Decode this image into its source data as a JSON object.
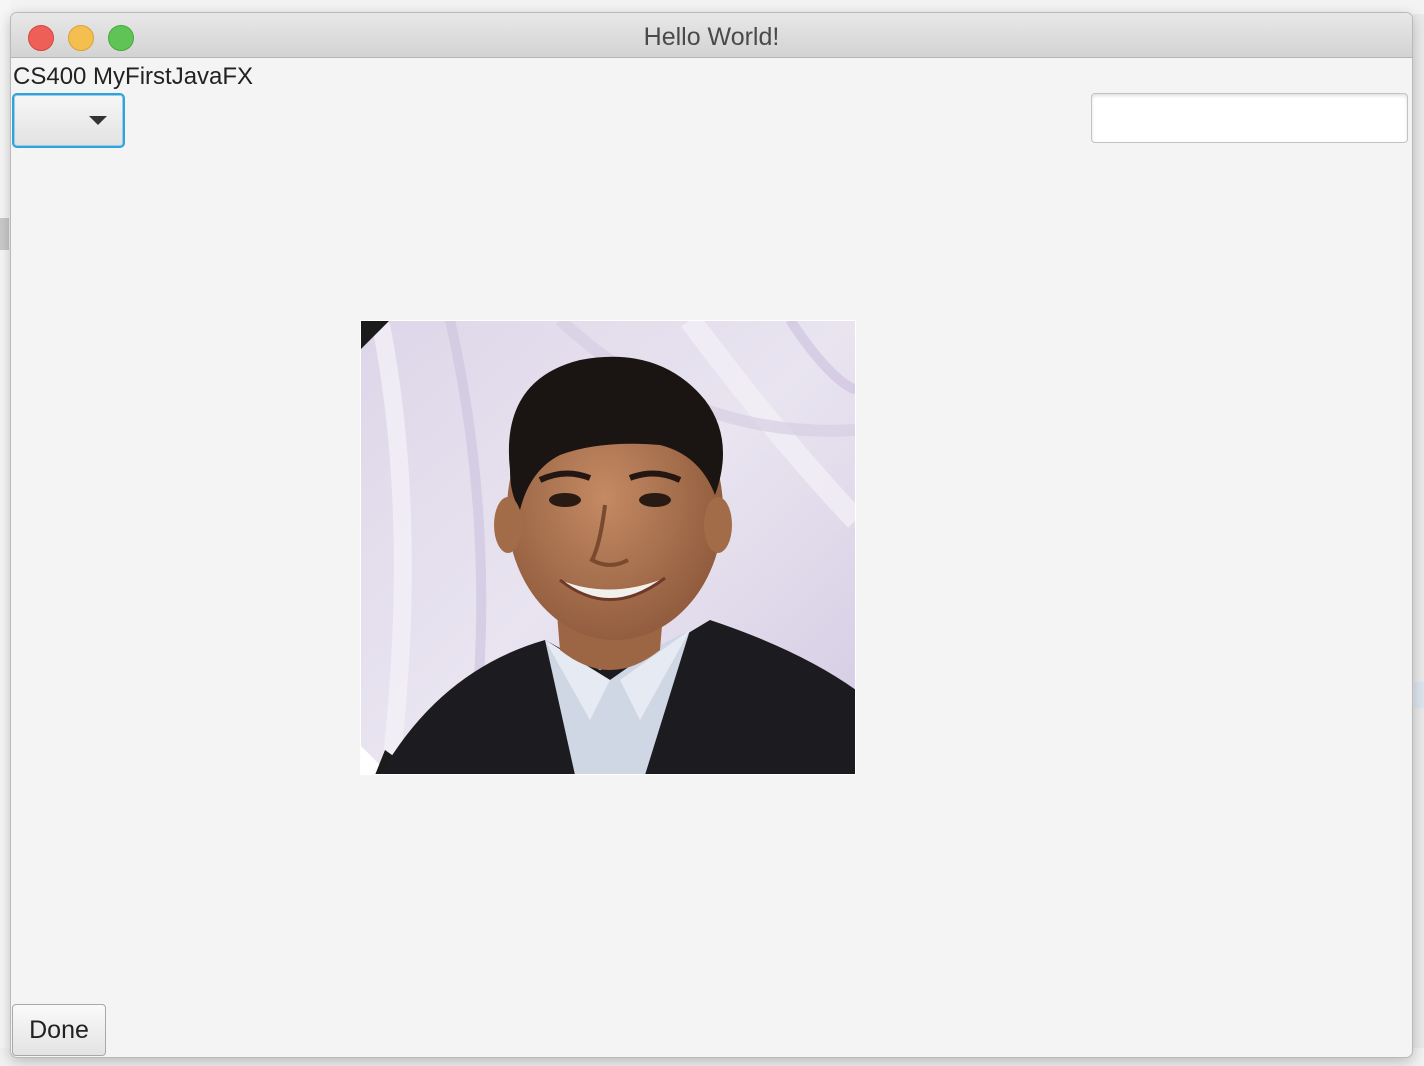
{
  "window": {
    "title": "Hello World!"
  },
  "app": {
    "label": "CS400 MyFirstJavaFX"
  },
  "combo_box": {
    "selected_value": ""
  },
  "text_field": {
    "value": "",
    "placeholder": ""
  },
  "image": {
    "description_icon": "portrait-photo"
  },
  "buttons": {
    "done_label": "Done"
  },
  "colors": {
    "focus_accent": "#2fa3dc",
    "close": "#ed5f57",
    "minimize": "#f5bf4f",
    "maximize": "#5fc455"
  }
}
